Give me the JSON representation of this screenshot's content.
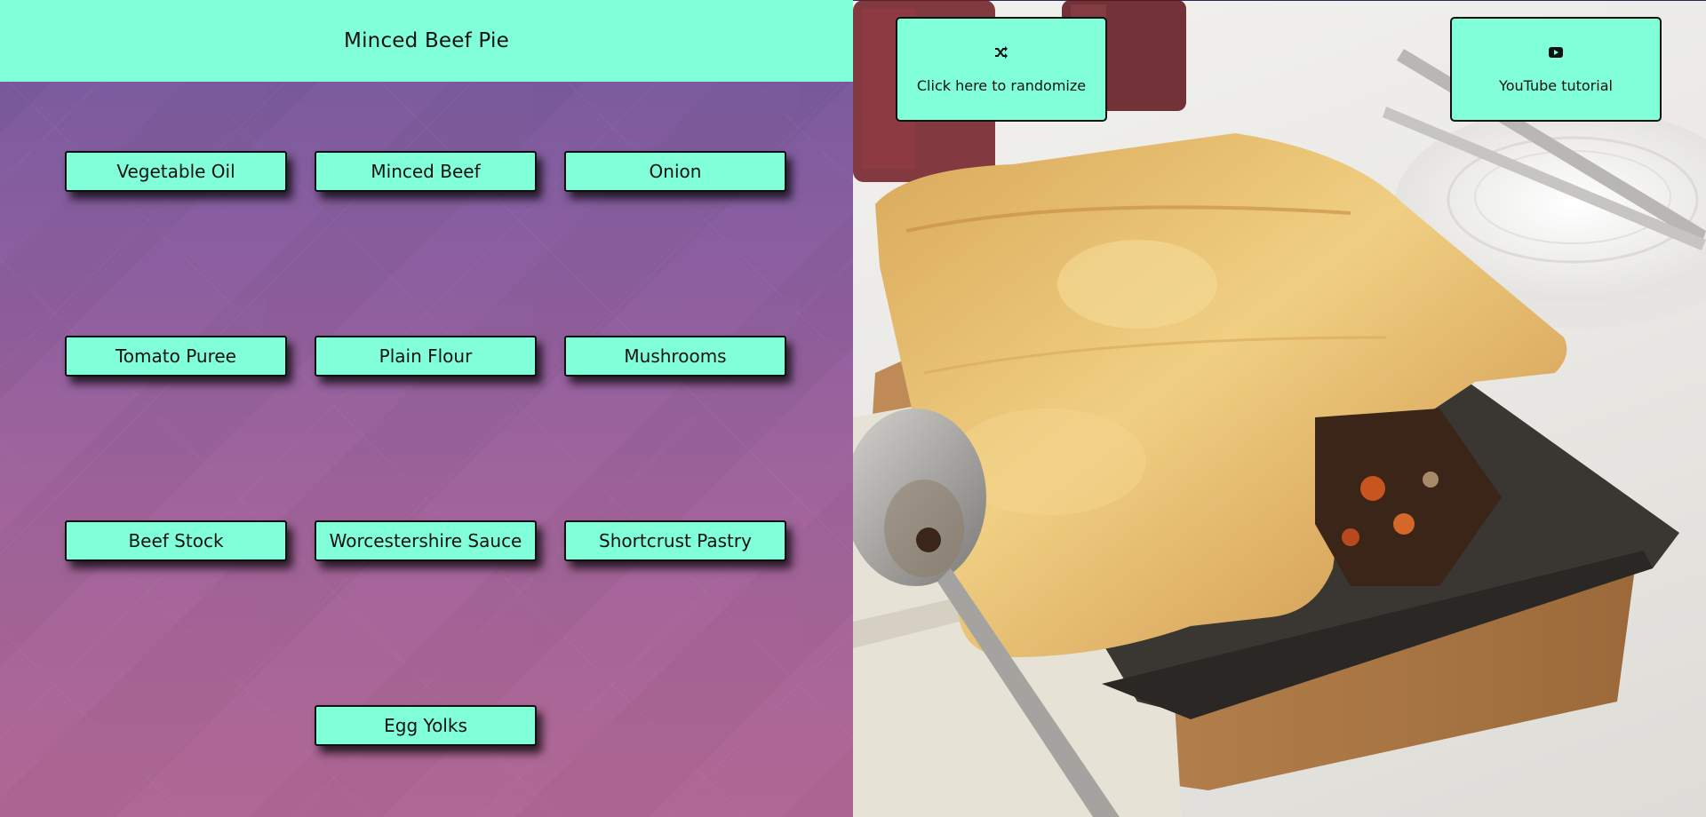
{
  "recipe": {
    "title": "Minced Beef Pie"
  },
  "ingredients": [
    {
      "label": "Vegetable Oil"
    },
    {
      "label": "Minced Beef"
    },
    {
      "label": "Onion"
    },
    {
      "label": "Tomato Puree"
    },
    {
      "label": "Plain Flour"
    },
    {
      "label": "Mushrooms"
    },
    {
      "label": "Beef Stock"
    },
    {
      "label": "Worcestershire Sauce"
    },
    {
      "label": "Shortcrust Pastry"
    },
    {
      "label": "Egg Yolks"
    }
  ],
  "actions": {
    "randomize": {
      "label": "Click here to randomize",
      "icon": "shuffle-icon"
    },
    "tutorial": {
      "label": "YouTube tutorial",
      "icon": "youtube-icon"
    }
  },
  "photo": {
    "subject": "minced-beef-pie-photo"
  },
  "colors": {
    "accent": "#80ffd8",
    "panel_top": "#745a9e",
    "panel_bottom": "#b06894"
  }
}
